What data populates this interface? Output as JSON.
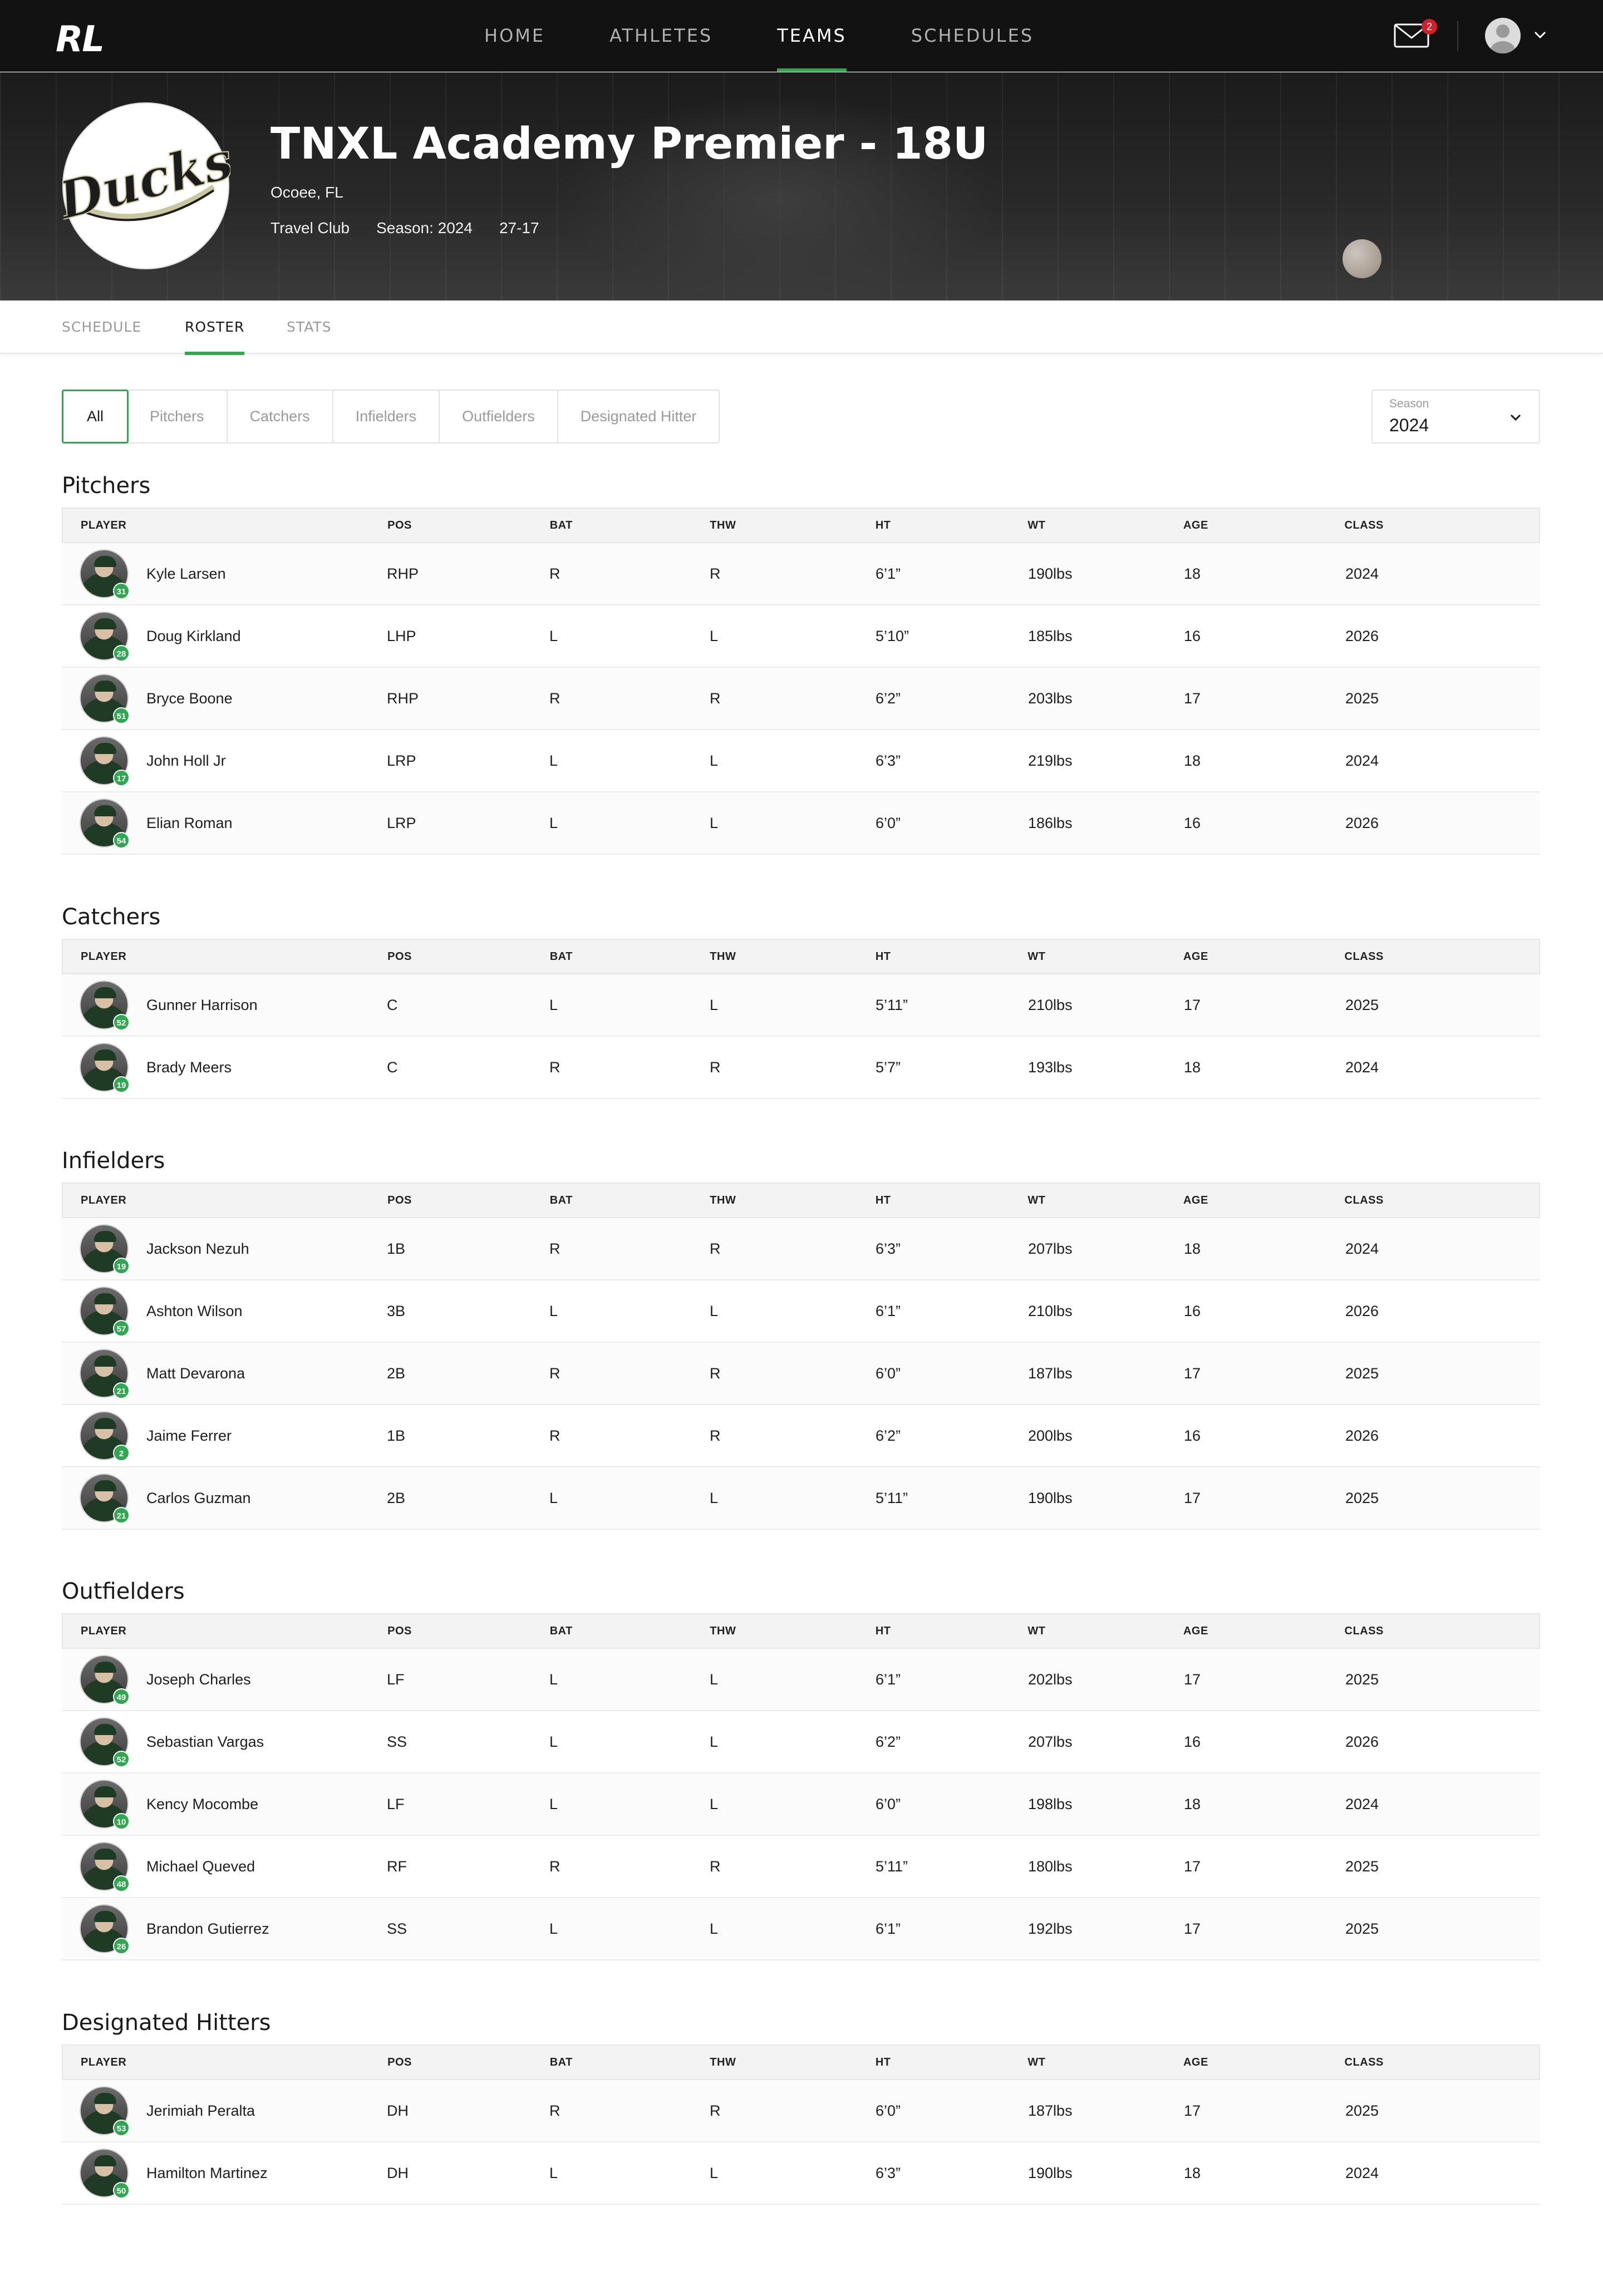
{
  "nav": {
    "logo": "RL",
    "links": [
      "HOME",
      "ATHLETES",
      "TEAMS",
      "SCHEDULES"
    ],
    "active": "TEAMS",
    "mail_badge": "2"
  },
  "team": {
    "logo_text": "Ducks",
    "name": "TNXL Academy Premier - 18U",
    "location": "Ocoee, FL",
    "type": "Travel Club",
    "season": "Season: 2024",
    "record": "27-17"
  },
  "subtabs": [
    "SCHEDULE",
    "ROSTER",
    "STATS"
  ],
  "filters": [
    "All",
    "Pitchers",
    "Catchers",
    "Infielders",
    "Outfielders",
    "Designated Hitter"
  ],
  "season_select": {
    "label": "Season",
    "value": "2024"
  },
  "columns": [
    "PLAYER",
    "POS",
    "BAT",
    "THW",
    "HT",
    "WT",
    "AGE",
    "CLASS"
  ],
  "sections": [
    {
      "title": "Pitchers",
      "rows": [
        {
          "num": "31",
          "name": "Kyle Larsen",
          "pos": "RHP",
          "bat": "R",
          "thw": "R",
          "ht": "6’1”",
          "wt": "190lbs",
          "age": "18",
          "class": "2024"
        },
        {
          "num": "28",
          "name": "Doug Kirkland",
          "pos": "LHP",
          "bat": "L",
          "thw": "L",
          "ht": "5’10”",
          "wt": "185lbs",
          "age": "16",
          "class": "2026"
        },
        {
          "num": "51",
          "name": "Bryce Boone",
          "pos": "RHP",
          "bat": "R",
          "thw": "R",
          "ht": "6’2”",
          "wt": "203lbs",
          "age": "17",
          "class": "2025"
        },
        {
          "num": "17",
          "name": "John Holl Jr",
          "pos": "LRP",
          "bat": "L",
          "thw": "L",
          "ht": "6’3”",
          "wt": "219lbs",
          "age": "18",
          "class": "2024"
        },
        {
          "num": "54",
          "name": "Elian Roman",
          "pos": "LRP",
          "bat": "L",
          "thw": "L",
          "ht": "6’0”",
          "wt": "186lbs",
          "age": "16",
          "class": "2026"
        }
      ]
    },
    {
      "title": "Catchers",
      "rows": [
        {
          "num": "52",
          "name": "Gunner Harrison",
          "pos": "C",
          "bat": "L",
          "thw": "L",
          "ht": "5’11”",
          "wt": "210lbs",
          "age": "17",
          "class": "2025"
        },
        {
          "num": "19",
          "name": "Brady Meers",
          "pos": "C",
          "bat": "R",
          "thw": "R",
          "ht": "5’7”",
          "wt": "193lbs",
          "age": "18",
          "class": "2024"
        }
      ]
    },
    {
      "title": "Infielders",
      "rows": [
        {
          "num": "19",
          "name": "Jackson Nezuh",
          "pos": "1B",
          "bat": "R",
          "thw": "R",
          "ht": "6’3”",
          "wt": "207lbs",
          "age": "18",
          "class": "2024"
        },
        {
          "num": "57",
          "name": "Ashton Wilson",
          "pos": "3B",
          "bat": "L",
          "thw": "L",
          "ht": "6’1”",
          "wt": "210lbs",
          "age": "16",
          "class": "2026"
        },
        {
          "num": "21",
          "name": "Matt Devarona",
          "pos": "2B",
          "bat": "R",
          "thw": "R",
          "ht": "6’0”",
          "wt": "187lbs",
          "age": "17",
          "class": "2025"
        },
        {
          "num": "2",
          "name": "Jaime Ferrer",
          "pos": "1B",
          "bat": "R",
          "thw": "R",
          "ht": "6’2”",
          "wt": "200lbs",
          "age": "16",
          "class": "2026"
        },
        {
          "num": "21",
          "name": "Carlos Guzman",
          "pos": "2B",
          "bat": "L",
          "thw": "L",
          "ht": "5’11”",
          "wt": "190lbs",
          "age": "17",
          "class": "2025"
        }
      ]
    },
    {
      "title": "Outfielders",
      "rows": [
        {
          "num": "49",
          "name": "Joseph Charles",
          "pos": "LF",
          "bat": "L",
          "thw": "L",
          "ht": "6’1”",
          "wt": "202lbs",
          "age": "17",
          "class": "2025"
        },
        {
          "num": "52",
          "name": "Sebastian Vargas",
          "pos": "SS",
          "bat": "L",
          "thw": "L",
          "ht": "6’2”",
          "wt": "207lbs",
          "age": "16",
          "class": "2026"
        },
        {
          "num": "10",
          "name": "Kency Mocombe",
          "pos": "LF",
          "bat": "L",
          "thw": "L",
          "ht": "6’0”",
          "wt": "198lbs",
          "age": "18",
          "class": "2024"
        },
        {
          "num": "48",
          "name": "Michael Queved",
          "pos": "RF",
          "bat": "R",
          "thw": "R",
          "ht": "5’11”",
          "wt": "180lbs",
          "age": "17",
          "class": "2025"
        },
        {
          "num": "26",
          "name": "Brandon Gutierrez",
          "pos": "SS",
          "bat": "L",
          "thw": "L",
          "ht": "6’1”",
          "wt": "192lbs",
          "age": "17",
          "class": "2025"
        }
      ]
    },
    {
      "title": "Designated Hitters",
      "rows": [
        {
          "num": "53",
          "name": "Jerimiah Peralta",
          "pos": "DH",
          "bat": "R",
          "thw": "R",
          "ht": "6’0”",
          "wt": "187lbs",
          "age": "17",
          "class": "2025"
        },
        {
          "num": "50",
          "name": "Hamilton Martinez",
          "pos": "DH",
          "bat": "L",
          "thw": "L",
          "ht": "6’3”",
          "wt": "190lbs",
          "age": "18",
          "class": "2024"
        }
      ]
    }
  ],
  "colors": {
    "accent": "#2fa84f",
    "nav_bg": "#121212",
    "badge": "#d0202a"
  }
}
